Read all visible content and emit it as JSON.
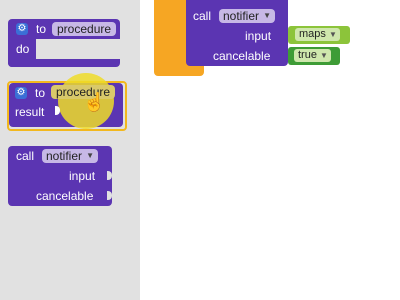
{
  "flyout": {
    "proc_do": {
      "to_label": "to",
      "name_label": "procedure",
      "do_label": "do"
    },
    "proc_result": {
      "to_label": "to",
      "name_label": "procedure",
      "result_label": "result"
    },
    "call_notifier": {
      "call_label": "call",
      "component": "notifier",
      "input_label": "input",
      "cancelable_label": "cancelable"
    }
  },
  "workspace": {
    "call_block": {
      "call_label": "call",
      "component": "notifier",
      "input_label": "input",
      "cancelable_label": "cancelable"
    },
    "input_value": "maps",
    "cancelable_value": "true"
  },
  "icons": {
    "gear": "gear-icon",
    "dropdown": "dropdown-arrow-icon",
    "cursor": "hand-cursor-icon"
  },
  "colors": {
    "procedure_block": "#5b35b2",
    "flyout_bg": "#e1e1e1",
    "text_block": "#8cc43a",
    "logic_block": "#3e9c36",
    "control_block": "#f6a623",
    "highlight": "#f2b81e"
  }
}
